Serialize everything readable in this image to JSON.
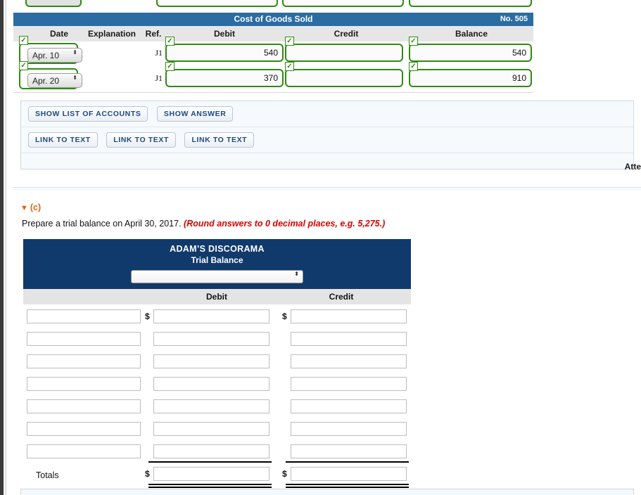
{
  "ledger": {
    "title": "Cost of Goods Sold",
    "account_no": "No. 505",
    "columns": {
      "date": "Date",
      "explanation": "Explanation",
      "ref": "Ref.",
      "debit": "Debit",
      "credit": "Credit",
      "balance": "Balance"
    },
    "check_glyph": "✓",
    "spinner_glyph": "⬍",
    "rows": [
      {
        "date": "Apr. 10",
        "explanation": "",
        "ref": "J1",
        "debit": "540",
        "credit": "",
        "balance": "540"
      },
      {
        "date": "Apr. 20",
        "explanation": "",
        "ref": "J1",
        "debit": "370",
        "credit": "",
        "balance": "910"
      }
    ]
  },
  "action_panel": {
    "row1": [
      {
        "label": "SHOW LIST OF ACCOUNTS",
        "name": "show-list-of-accounts-button"
      },
      {
        "label": "SHOW ANSWER",
        "name": "show-answer-button"
      }
    ],
    "row2": [
      {
        "label": "LINK TO TEXT",
        "name": "link-to-text-button-1"
      },
      {
        "label": "LINK TO TEXT",
        "name": "link-to-text-button-2"
      },
      {
        "label": "LINK TO TEXT",
        "name": "link-to-text-button-3"
      }
    ]
  },
  "attempts_label": "Atte",
  "part_c": {
    "marker": "(c)",
    "triangle_glyph": "▼",
    "instruction_main": "Prepare a trial balance on April 30, 2017.",
    "instruction_warning": "(Round answers to 0 decimal places, e.g. 5,275.)"
  },
  "trial_balance": {
    "company": "ADAM’S DISCORAMA",
    "statement": "Trial Balance",
    "date_select_value": "",
    "date_select_placeholder": "",
    "spinner_glyph": "⬍",
    "columns": {
      "debit": "Debit",
      "credit": "Credit"
    },
    "dollar_sign": "$",
    "totals_label": "Totals",
    "rows": [
      {
        "account": "",
        "debit": "",
        "credit": "",
        "show_dollar": true
      },
      {
        "account": "",
        "debit": "",
        "credit": "",
        "show_dollar": false
      },
      {
        "account": "",
        "debit": "",
        "credit": "",
        "show_dollar": false
      },
      {
        "account": "",
        "debit": "",
        "credit": "",
        "show_dollar": false
      },
      {
        "account": "",
        "debit": "",
        "credit": "",
        "show_dollar": false
      },
      {
        "account": "",
        "debit": "",
        "credit": "",
        "show_dollar": false
      },
      {
        "account": "",
        "debit": "",
        "credit": "",
        "show_dollar": false
      }
    ],
    "totals": {
      "debit": "",
      "credit": ""
    }
  },
  "colors": {
    "ledger_header_blue": "#2b6ca3",
    "trial_balance_navy": "#103a6b",
    "correct_green": "#2e8b10",
    "warning_red": "#d80000",
    "part_marker_orange": "#e8620c",
    "button_text_navy": "#21497e"
  }
}
